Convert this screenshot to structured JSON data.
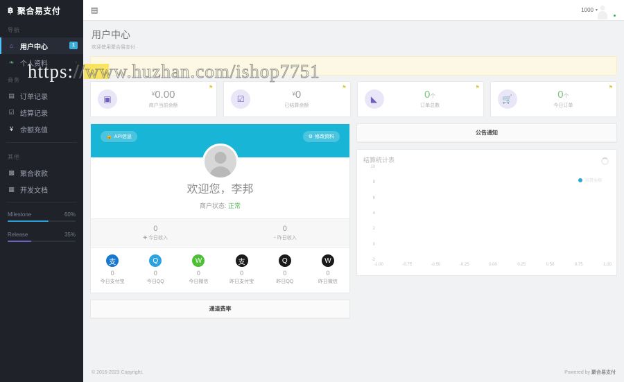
{
  "brand": {
    "logo": "฿",
    "name": "聚合易支付"
  },
  "sidebar": {
    "groups": [
      {
        "title": "导航",
        "items": [
          {
            "label": "用户中心",
            "icon": "home-icon",
            "badge": "1",
            "active": true
          },
          {
            "label": "个人资料",
            "icon": "leaf-icon",
            "chevron": "›",
            "active": false
          }
        ]
      },
      {
        "title": "商务",
        "items": [
          {
            "label": "订单记录",
            "icon": "list-icon",
            "active": false
          },
          {
            "label": "结算记录",
            "icon": "check-square-icon",
            "active": false
          },
          {
            "label": "余额充值",
            "icon": "yen-icon",
            "active": false
          }
        ]
      },
      {
        "title": "其他",
        "items": [
          {
            "label": "聚合收款",
            "icon": "qrcode-icon",
            "active": false
          },
          {
            "label": "开发文档",
            "icon": "book-icon",
            "active": false
          }
        ]
      }
    ],
    "progress": [
      {
        "label": "Milestone",
        "percent": "60%",
        "value": 60,
        "color": "#2b9fd8"
      },
      {
        "label": "Release",
        "percent": "35%",
        "value": 35,
        "color": "#6f5fbf"
      }
    ]
  },
  "topbar": {
    "menu_icon": "hamburger-icon",
    "user_label": "1000",
    "caret": "▾",
    "avatar": "user-avatar"
  },
  "page": {
    "title": "用户中心",
    "subtitle": "欢迎使用聚合易支付"
  },
  "watermark": {
    "prefix": "https:",
    "rest": "//www.huzhan.com/ishop7751"
  },
  "stats": [
    {
      "icon": "banknote-icon",
      "currency": "¥",
      "value": "0.00",
      "unit": "",
      "label": "商户当前余额",
      "green": false,
      "corner": "flag-icon"
    },
    {
      "icon": "check-square-icon",
      "currency": "¥",
      "value": "0",
      "unit": "",
      "label": "已结算余额",
      "green": false,
      "corner": "flag-icon"
    },
    {
      "icon": "chart-icon",
      "currency": "",
      "value": "0",
      "unit": "个",
      "label": "订单总数",
      "green": true,
      "corner": "flag-icon"
    },
    {
      "icon": "cart-icon",
      "currency": "",
      "value": "0",
      "unit": "个",
      "label": "今日订单",
      "green": true,
      "corner": "flag-icon"
    }
  ],
  "profile": {
    "api_button": "API信息",
    "api_icon": "lock-icon",
    "edit_button": "修改资料",
    "edit_icon": "gear-icon",
    "welcome": "欢迎您，李邦",
    "status_label": "商户状态:",
    "status_value": "正常",
    "status_color": "#5cb85c"
  },
  "income": [
    {
      "value": "0",
      "label": "今日收入",
      "icon": "plus-icon"
    },
    {
      "value": "0",
      "label": "昨日收入",
      "icon": "clock-icon"
    }
  ],
  "payments": [
    {
      "value": "0",
      "label": "今日支付宝",
      "icon": "alipay-icon",
      "color": "#1678ce"
    },
    {
      "value": "0",
      "label": "今日QQ",
      "icon": "qq-icon",
      "color": "#2ba3e3"
    },
    {
      "value": "0",
      "label": "今日微信",
      "icon": "wechat-icon",
      "color": "#4cbf34"
    },
    {
      "value": "0",
      "label": "昨日支付宝",
      "icon": "alipay-icon",
      "color": "#1a1a1a"
    },
    {
      "value": "0",
      "label": "昨日QQ",
      "icon": "qq-icon",
      "color": "#1a1a1a"
    },
    {
      "value": "0",
      "label": "昨日微信",
      "icon": "wechat-icon",
      "color": "#1a1a1a"
    }
  ],
  "notice": {
    "title": "公告通知"
  },
  "fee_card": {
    "title": "通道费率"
  },
  "footer": {
    "copyright": "© 2016-2023 Copyright.",
    "powered_prefix": "Powered by ",
    "powered_brand": "聚合易支付"
  },
  "chart_data": {
    "type": "line",
    "title": "结算统计表",
    "xlabel": "",
    "ylabel": "",
    "xlim": [
      -1.0,
      1.0
    ],
    "ylim": [
      -2,
      10
    ],
    "x_ticks": [
      "-1.00",
      "-0.75",
      "-0.50",
      "-0.25",
      "0.00",
      "0.25",
      "0.50",
      "0.75",
      "1.00"
    ],
    "y_ticks": [
      "10",
      "8",
      "6",
      "4",
      "2",
      "0",
      "-2"
    ],
    "grid": false,
    "legend_position": "top-right",
    "series": [
      {
        "name": "结算金额",
        "color": "#2fa8d8",
        "x": [],
        "values": []
      }
    ],
    "loading": true
  }
}
